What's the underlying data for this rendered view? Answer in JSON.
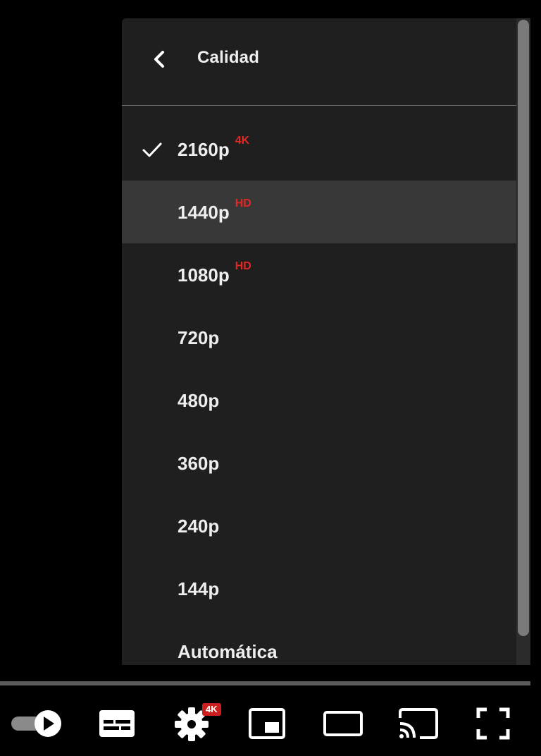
{
  "menu": {
    "title": "Calidad",
    "back_icon": "chevron-left-icon",
    "items": [
      {
        "label": "2160p",
        "badge": "4K",
        "selected": true
      },
      {
        "label": "1440p",
        "badge": "HD",
        "selected": false
      },
      {
        "label": "1080p",
        "badge": "HD",
        "selected": false
      },
      {
        "label": "720p",
        "badge": "",
        "selected": false
      },
      {
        "label": "480p",
        "badge": "",
        "selected": false
      },
      {
        "label": "360p",
        "badge": "",
        "selected": false
      },
      {
        "label": "240p",
        "badge": "",
        "selected": false
      },
      {
        "label": "144p",
        "badge": "",
        "selected": false
      },
      {
        "label": "Automática",
        "badge": "",
        "selected": false
      }
    ],
    "hovered_index": 1,
    "badge_color": "#e22727",
    "background_color": "#1f1f1f"
  },
  "controls": {
    "settings_badge": "4K",
    "icons": [
      "autoplay-toggle-icon",
      "subtitles-icon",
      "settings-gear-icon",
      "miniplayer-icon",
      "theater-mode-icon",
      "cast-icon",
      "fullscreen-icon"
    ]
  }
}
